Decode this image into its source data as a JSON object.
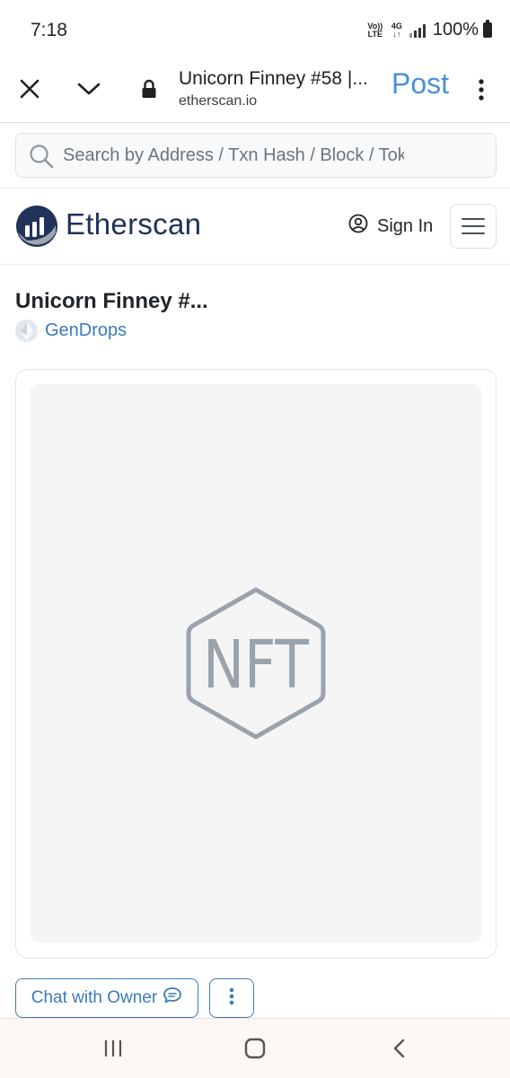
{
  "status_bar": {
    "time": "7:18",
    "volte": "Vo)) LTE",
    "network": "4G",
    "battery": "100%"
  },
  "browser": {
    "page_title": "Unicorn Finney #58 |...",
    "url": "etherscan.io",
    "post_label": "Post",
    "icons": [
      "close-icon",
      "chevron-down-icon",
      "lock-icon",
      "more-vertical-icon"
    ]
  },
  "search": {
    "placeholder": "Search by Address / Txn Hash / Block / Token"
  },
  "header": {
    "logo_text": "Etherscan",
    "sign_in": "Sign In"
  },
  "token": {
    "title": "Unicorn Finney #...",
    "collection": "GenDrops",
    "image_placeholder": "NFT"
  },
  "actions": {
    "chat_label": "Chat with Owner"
  },
  "colors": {
    "brand_navy": "#21325b",
    "link_blue": "#3a7bb8",
    "post_blue": "#4a90d9",
    "placeholder_gray": "#9aa2ab"
  }
}
